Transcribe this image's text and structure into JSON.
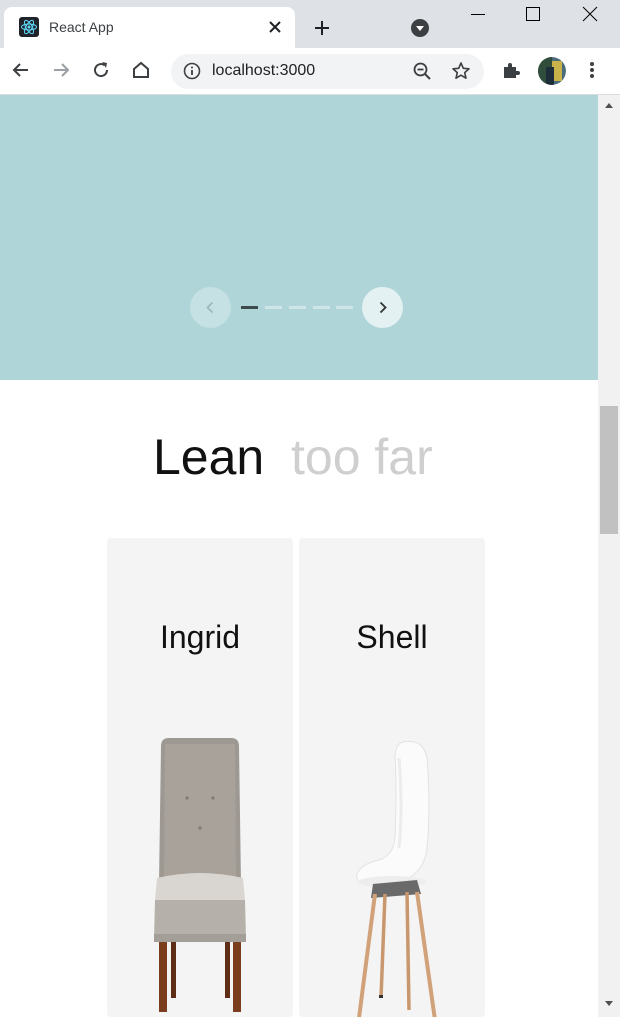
{
  "browser": {
    "tab_title": "React App",
    "url": "localhost:3000"
  },
  "icons": {
    "favicon": "react-logo-icon",
    "tab_close": "close-icon",
    "new_tab": "plus-icon",
    "tab_search": "tab-search-icon",
    "back": "arrow-left-icon",
    "forward": "arrow-right-icon",
    "reload": "reload-icon",
    "home": "home-icon",
    "site_info": "info-icon",
    "zoom": "zoom-out-icon",
    "bookmark": "star-icon",
    "extensions": "puzzle-icon",
    "menu": "kebab-menu-icon"
  },
  "hero": {
    "background": "#b0d5d8",
    "slides": 5,
    "active_slide": 1
  },
  "section": {
    "heading_main": "Lean",
    "heading_sub": "too far"
  },
  "products": [
    {
      "name": "Ingrid"
    },
    {
      "name": "Shell"
    }
  ]
}
